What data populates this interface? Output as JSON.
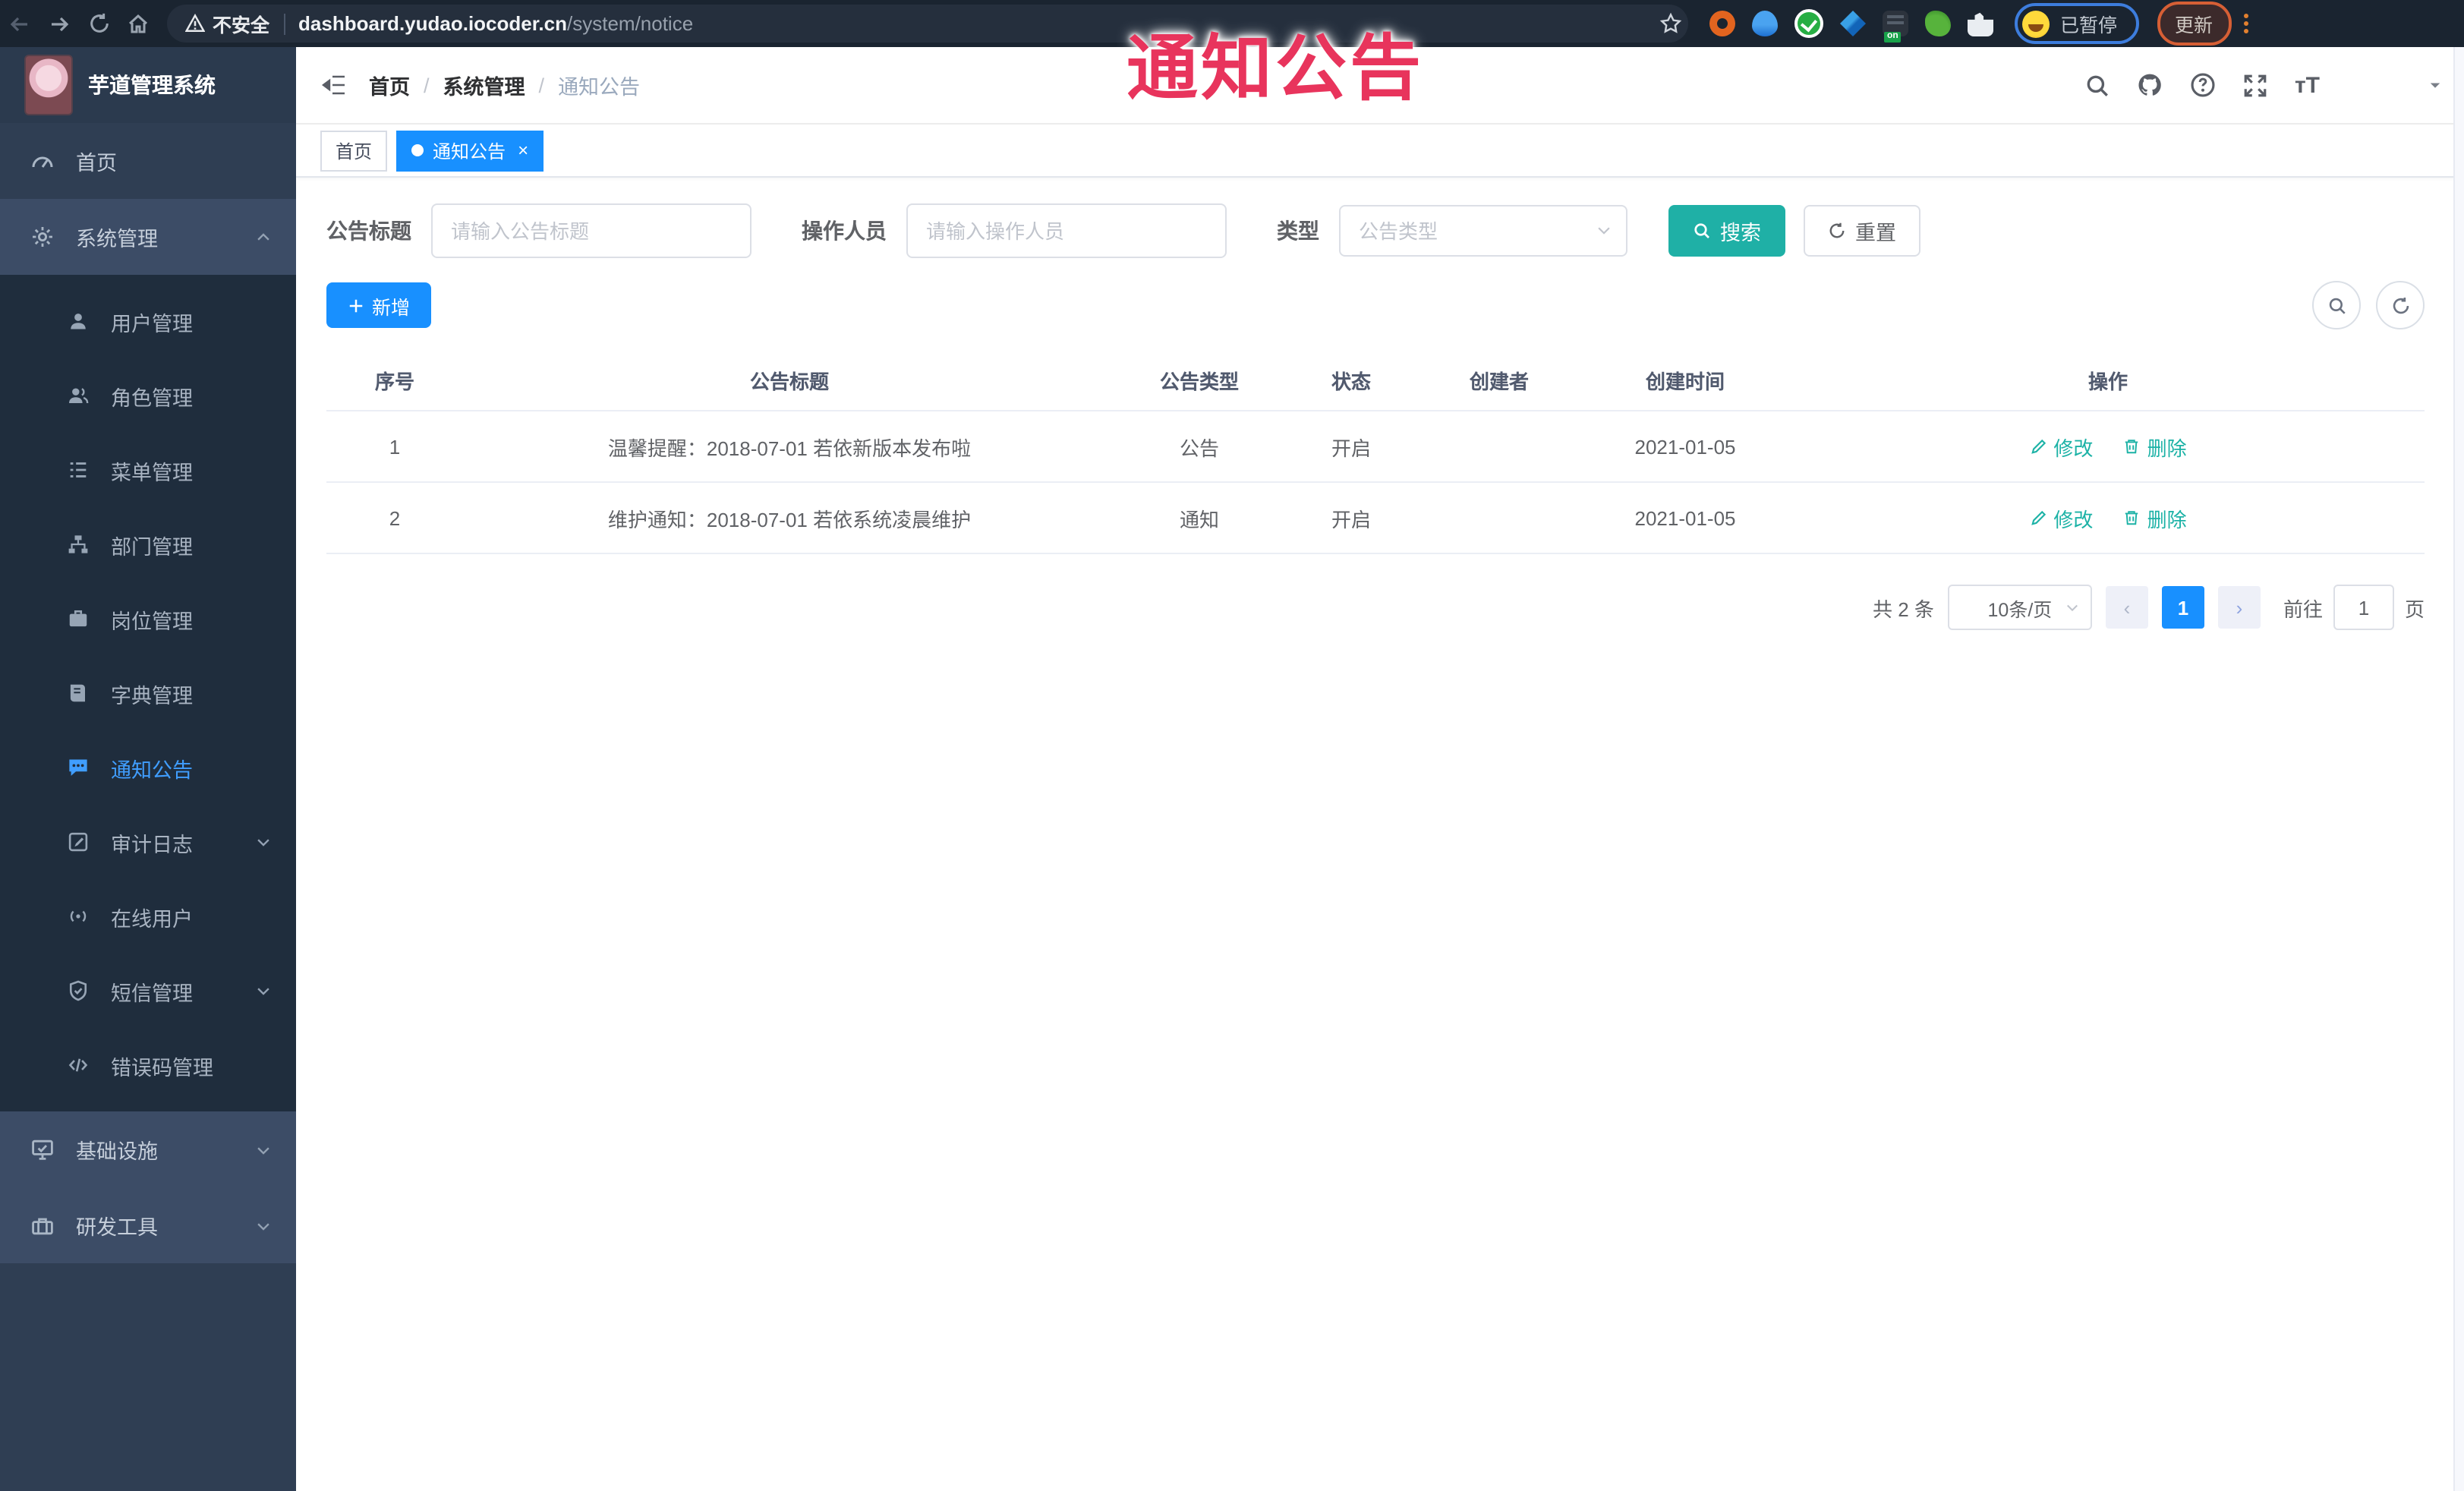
{
  "browser": {
    "security_label": "不安全",
    "url_host": "dashboard.yudao.iocoder.cn",
    "url_path": "/system/notice",
    "extension_badge": "on",
    "profile_label": "已暂停",
    "update_label": "更新"
  },
  "overlay": {
    "title": "通知公告",
    "color": "#e8345c"
  },
  "sidebar": {
    "logo_title": "芋道管理系统",
    "home": "首页",
    "system": "系统管理",
    "submenu": [
      {
        "label": "用户管理"
      },
      {
        "label": "角色管理"
      },
      {
        "label": "菜单管理"
      },
      {
        "label": "部门管理"
      },
      {
        "label": "岗位管理"
      },
      {
        "label": "字典管理"
      },
      {
        "label": "通知公告"
      },
      {
        "label": "审计日志"
      },
      {
        "label": "在线用户"
      },
      {
        "label": "短信管理"
      },
      {
        "label": "错误码管理"
      }
    ],
    "infra": "基础设施",
    "devtools": "研发工具",
    "active_item": "通知公告"
  },
  "header": {
    "breadcrumb": [
      "首页",
      "系统管理",
      "通知公告"
    ],
    "separator": "/"
  },
  "tags": {
    "items": [
      {
        "label": "首页"
      },
      {
        "label": "通知公告"
      }
    ],
    "close_glyph": "×"
  },
  "filters": {
    "title_label": "公告标题",
    "title_placeholder": "请输入公告标题",
    "operator_label": "操作人员",
    "operator_placeholder": "请输入操作人员",
    "type_label": "类型",
    "type_placeholder": "公告类型",
    "search_label": "搜索",
    "reset_label": "重置"
  },
  "toolbar": {
    "add_label": "新增"
  },
  "table": {
    "headers": [
      "序号",
      "公告标题",
      "公告类型",
      "状态",
      "创建者",
      "创建时间",
      "操作"
    ],
    "rows": [
      {
        "no": "1",
        "title": "温馨提醒：2018-07-01 若依新版本发布啦",
        "type": "公告",
        "status": "开启",
        "creator": "",
        "created": "2021-01-05",
        "edit": "修改",
        "delete": "删除"
      },
      {
        "no": "2",
        "title": "维护通知：2018-07-01 若依系统凌晨维护",
        "type": "通知",
        "status": "开启",
        "creator": "",
        "created": "2021-01-05",
        "edit": "修改",
        "delete": "删除"
      }
    ]
  },
  "pagination": {
    "total": "共 2 条",
    "page_size": "10条/页",
    "prev": "‹",
    "current": "1",
    "next": "›",
    "goto_label": "前往",
    "goto_value": "1",
    "unit": "页"
  },
  "colors": {
    "primary": "#1890ff",
    "teal": "#1fb0a6",
    "action_link": "#1cb2a6",
    "sidebar_bg": "#2f3e53",
    "submenu_bg": "#1f2d3d",
    "active_menu": "#409eff",
    "overlay_red": "#e8345c"
  }
}
